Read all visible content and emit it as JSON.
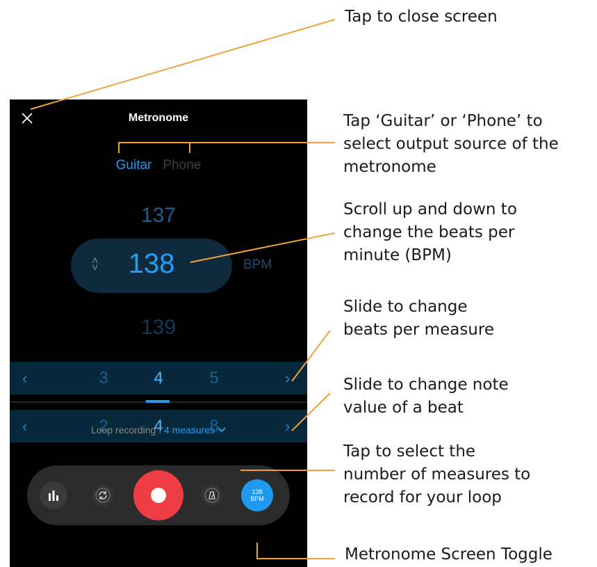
{
  "app": {
    "title": "Metronome",
    "close_icon": "close-icon"
  },
  "output": {
    "guitar_label": "Guitar",
    "phone_label": "Phone",
    "selected": "Guitar"
  },
  "bpm": {
    "prev": "137",
    "current": "138",
    "next": "139",
    "unit": "BPM"
  },
  "beats_per_measure": {
    "values": [
      "3",
      "4",
      "5"
    ],
    "selected": "4"
  },
  "note_value": {
    "values": [
      "2",
      "4",
      "8"
    ],
    "selected": "4"
  },
  "loop_recording": {
    "label": "Loop recording : ",
    "value": "4 measures"
  },
  "controls": {
    "metronome_toggle_value": "138",
    "metronome_toggle_unit": "BPM"
  },
  "annotations": {
    "close": "Tap to close screen",
    "output_source": [
      "Tap ‘Guitar’ or ‘Phone’ to",
      "select output source of the",
      "metronome"
    ],
    "bpm": [
      "Scroll up and down to",
      "change the beats per",
      "minute (BPM)"
    ],
    "beats": [
      "Slide to change",
      "beats per measure"
    ],
    "note_value": [
      "Slide to change note",
      "value of a beat"
    ],
    "measures": [
      "Tap to select the",
      "number of measures to",
      "record for your loop"
    ],
    "toggle": "Metronome Screen Toggle"
  },
  "colors": {
    "accent": "#1e9bf0",
    "record": "#ef3d45",
    "callout_line": "#f0a23a"
  }
}
